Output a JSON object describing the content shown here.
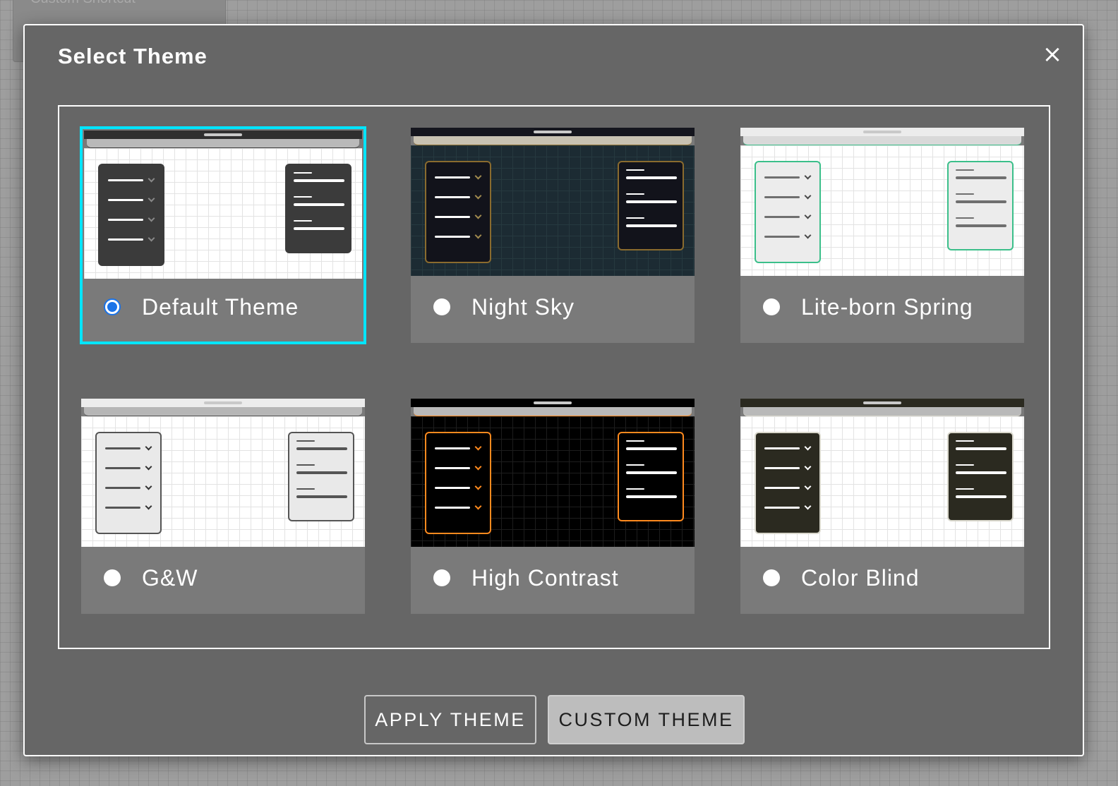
{
  "background": {
    "shortcut_label": "Custom Shortcut"
  },
  "dialog": {
    "title": "Select Theme",
    "close_label": "×"
  },
  "themes": [
    {
      "label": "Default Theme",
      "selected": true,
      "colors": {
        "topbar": "#2f2f2f",
        "bar": "#b9b9b9",
        "grid_bg": "#ffffff",
        "grid_line": "#e3e3e3",
        "panel": "#3b3b3b",
        "panel_border": "#3b3b3b",
        "row": "#ffffff",
        "chevron": "#888888"
      }
    },
    {
      "label": "Night Sky",
      "selected": false,
      "colors": {
        "topbar": "#15161e",
        "bar": "#c8c2b2",
        "grid_bg": "#1c2b33",
        "grid_line": "#26393f",
        "panel": "#12131b",
        "panel_border": "#8a6b2e",
        "row": "#ffffff",
        "chevron": "#a08a4e"
      }
    },
    {
      "label": "Lite-born Spring",
      "selected": false,
      "colors": {
        "topbar": "#ececec",
        "bar": "#d9d9d9",
        "grid_bg": "#ffffff",
        "grid_line": "#e3e3e3",
        "panel": "#ececec",
        "panel_border": "#3bbf8a",
        "row": "#6f6f6f",
        "chevron": "#4a4a4a"
      }
    },
    {
      "label": "G&W",
      "selected": false,
      "colors": {
        "topbar": "#ececec",
        "bar": "#b6b6b6",
        "grid_bg": "#ffffff",
        "grid_line": "#e3e3e3",
        "panel": "#e9e9e9",
        "panel_border": "#555555",
        "row": "#555555",
        "chevron": "#333333"
      }
    },
    {
      "label": "High Contrast",
      "selected": false,
      "colors": {
        "topbar": "#000000",
        "bar": "#b9b9b9",
        "grid_bg": "#000000",
        "grid_line": "#1d1d1d",
        "panel": "#000000",
        "panel_border": "#ff8a1e",
        "row": "#ffffff",
        "chevron": "#ff8a1e"
      }
    },
    {
      "label": "Color Blind",
      "selected": false,
      "colors": {
        "topbar": "#2b2a20",
        "bar": "#b9b9b9",
        "grid_bg": "#ffffff",
        "grid_line": "#e3e3e3",
        "panel": "#2b2a20",
        "panel_border": "#d9d7cc",
        "row": "#ffffff",
        "chevron": "#ffffff"
      }
    }
  ],
  "buttons": {
    "apply": "APPLY THEME",
    "custom": "CUSTOM THEME"
  }
}
